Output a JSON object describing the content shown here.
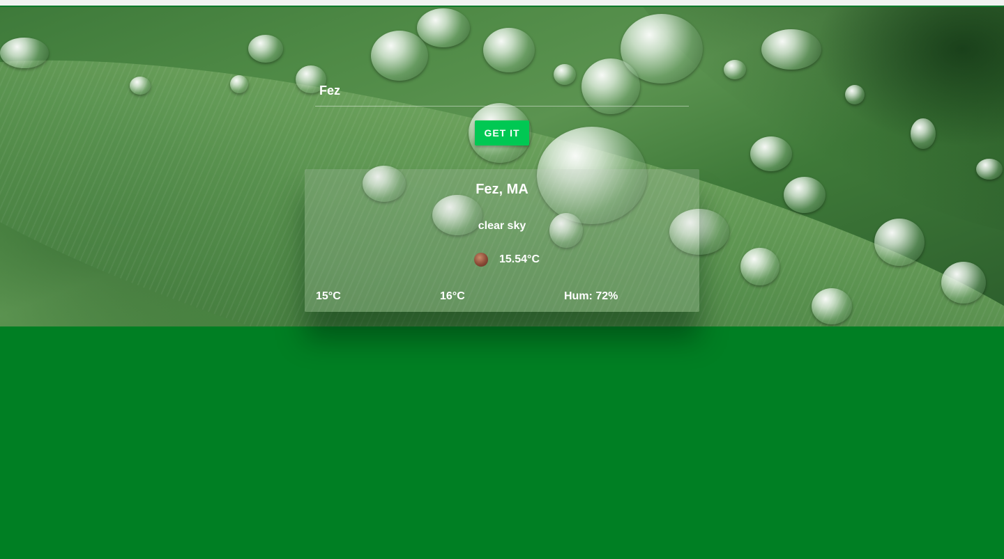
{
  "search": {
    "value": "Fez",
    "button_label": "GET IT"
  },
  "weather": {
    "location": "Fez, MA",
    "description": "clear sky",
    "icon": "weather-condition-icon",
    "temperature": "15.54°C",
    "temp_min": "15°C",
    "temp_max": "16°C",
    "humidity": "Hum: 72%"
  },
  "colors": {
    "page_background": "#007f23",
    "button": "#00c853"
  }
}
